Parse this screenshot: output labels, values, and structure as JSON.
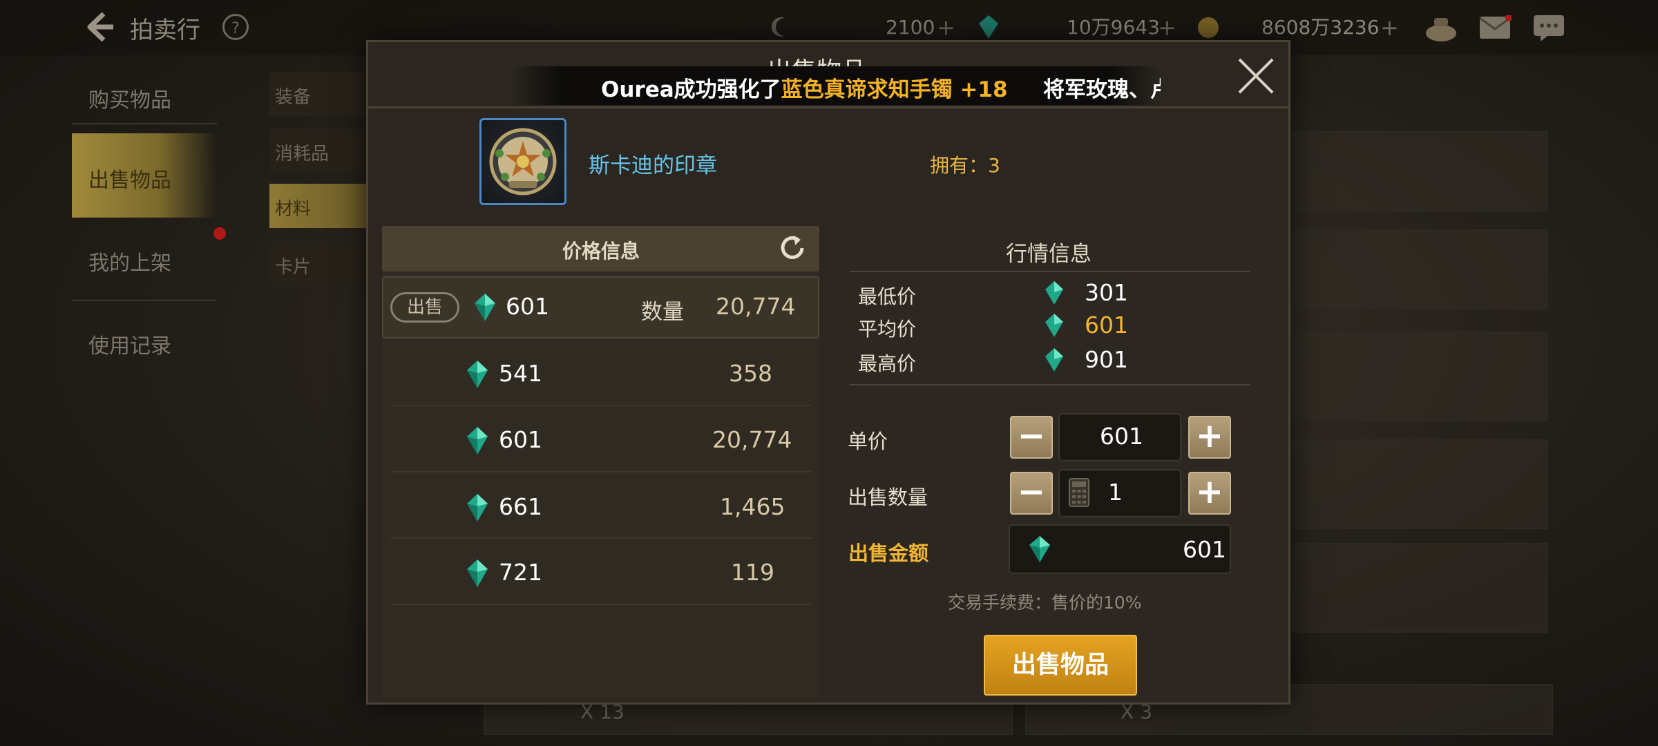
{
  "topbar": {
    "title": "拍卖行",
    "currency1": "2100",
    "currency2": "10万9643",
    "currency3": "8608万3236",
    "plus_symbol": "+"
  },
  "nav": {
    "items": [
      {
        "label": "购买物品"
      },
      {
        "label": "出售物品"
      },
      {
        "label": "我的上架"
      },
      {
        "label": "使用记录"
      }
    ],
    "sub_tabs": [
      {
        "label": "装备"
      },
      {
        "label": "消耗品"
      },
      {
        "label": "材料"
      },
      {
        "label": "卡片"
      }
    ]
  },
  "background": {
    "qty_left": "X 13",
    "qty_right": "X 3"
  },
  "modal": {
    "title": "出售物品",
    "ticker": {
      "prefix": "Ourea成功强化了",
      "highlight": "蓝色真谛求知手镯 +18",
      "next": "将军玫瑰、卢"
    },
    "item": {
      "name": "斯卡迪的印章",
      "owned_label": "拥有：3"
    },
    "price_panel": {
      "header": "价格信息",
      "sell_tag": "出售",
      "qty_label": "数量",
      "selected": {
        "price": "601",
        "qty": "20,774"
      },
      "rows": [
        {
          "price": "541",
          "qty": "358"
        },
        {
          "price": "601",
          "qty": "20,774"
        },
        {
          "price": "661",
          "qty": "1,465"
        },
        {
          "price": "721",
          "qty": "119"
        }
      ]
    },
    "market": {
      "title": "行情信息",
      "min_label": "最低价",
      "min_value": "301",
      "avg_label": "平均价",
      "avg_value": "601",
      "max_label": "最高价",
      "max_value": "901"
    },
    "form": {
      "unit_price_label": "单价",
      "unit_price_value": "601",
      "quantity_label": "出售数量",
      "quantity_value": "1",
      "amount_label": "出售金额",
      "amount_value": "601",
      "fee_text": "交易手续费：售价的10%",
      "minus": "−",
      "plus": "+",
      "sell_button": "出售物品"
    },
    "colors": {
      "gold_accent": "#f2b534",
      "item_name": "#67c4ea",
      "avg_price": "#f2b534"
    }
  }
}
